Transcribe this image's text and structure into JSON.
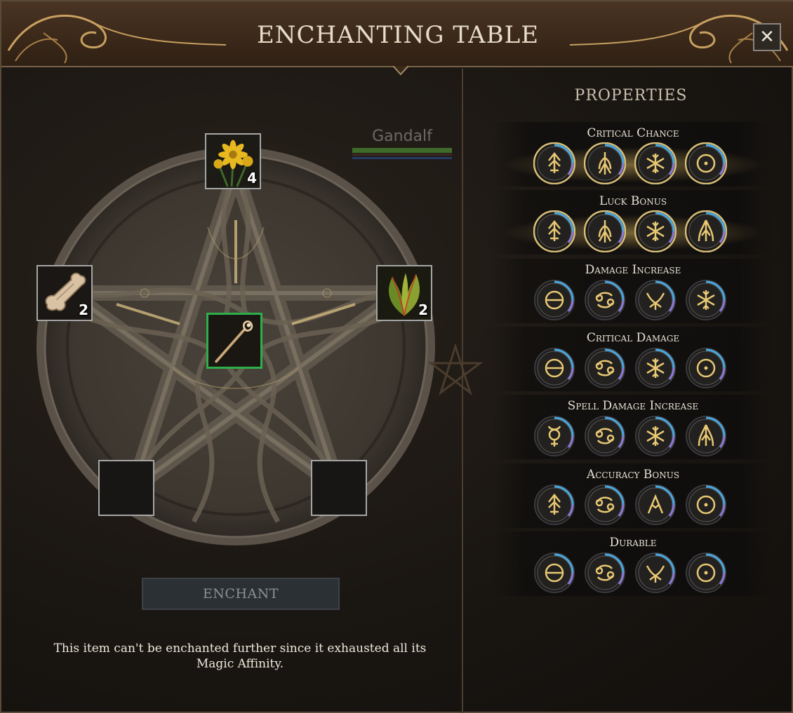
{
  "window": {
    "title": "ENCHANTING TABLE",
    "close_label": "✕"
  },
  "character": {
    "name": "Gandalf",
    "bar_colors": [
      "#3f6b2a",
      "#263a6a"
    ]
  },
  "slots": [
    {
      "id": "top",
      "item": "yellow-flower-icon",
      "count": "4"
    },
    {
      "id": "left",
      "item": "bone-icon",
      "count": "2"
    },
    {
      "id": "right",
      "item": "green-leaf-icon",
      "count": "2"
    },
    {
      "id": "center",
      "item": "magic-staff-icon",
      "count": ""
    },
    {
      "id": "bottom-left",
      "item": "",
      "count": ""
    },
    {
      "id": "bottom-right",
      "item": "",
      "count": ""
    }
  ],
  "enchant_button": {
    "label": "ENCHANT"
  },
  "status_text": "This item can't be enchanted further since it exhausted all its Magic Affinity.",
  "properties": {
    "title": "PROPERTIES",
    "rows": [
      {
        "name": "Critical Chance",
        "highlighted": true,
        "runes": [
          "arrow-rune-icon",
          "tree-rune-icon",
          "snowflake-rune-icon",
          "circle-dot-rune-icon"
        ]
      },
      {
        "name": "Luck Bonus",
        "highlighted": true,
        "runes": [
          "arrow-rune-icon",
          "tree-rune-icon",
          "snowflake-rune-icon",
          "flame-rune-icon"
        ]
      },
      {
        "name": "Damage Increase",
        "highlighted": false,
        "runes": [
          "theta-rune-icon",
          "cancer-rune-icon",
          "fork-rune-icon",
          "snowflake-rune-icon"
        ]
      },
      {
        "name": "Critical Damage",
        "highlighted": false,
        "runes": [
          "theta-rune-icon",
          "cancer-rune-icon",
          "snowflake-rune-icon",
          "circle-dot-rune-icon"
        ]
      },
      {
        "name": "Spell Damage Increase",
        "highlighted": false,
        "runes": [
          "mercury-rune-icon",
          "cancer-rune-icon",
          "snowflake-rune-icon",
          "flame-rune-icon"
        ]
      },
      {
        "name": "Accuracy Bonus",
        "highlighted": false,
        "runes": [
          "arrow-rune-icon",
          "cancer-rune-icon",
          "lambda-rune-icon",
          "circle-dot-rune-icon"
        ]
      },
      {
        "name": "Durable",
        "highlighted": false,
        "runes": [
          "theta-rune-icon",
          "cancer-rune-icon",
          "fork-rune-icon",
          "circle-dot-rune-icon"
        ]
      }
    ]
  },
  "colors": {
    "rune_gold": "#e8c873",
    "rune_ring_blue": "#4aa8e0",
    "rune_ring_violet": "#8a7ad8",
    "active_slot": "#2fae4a"
  }
}
